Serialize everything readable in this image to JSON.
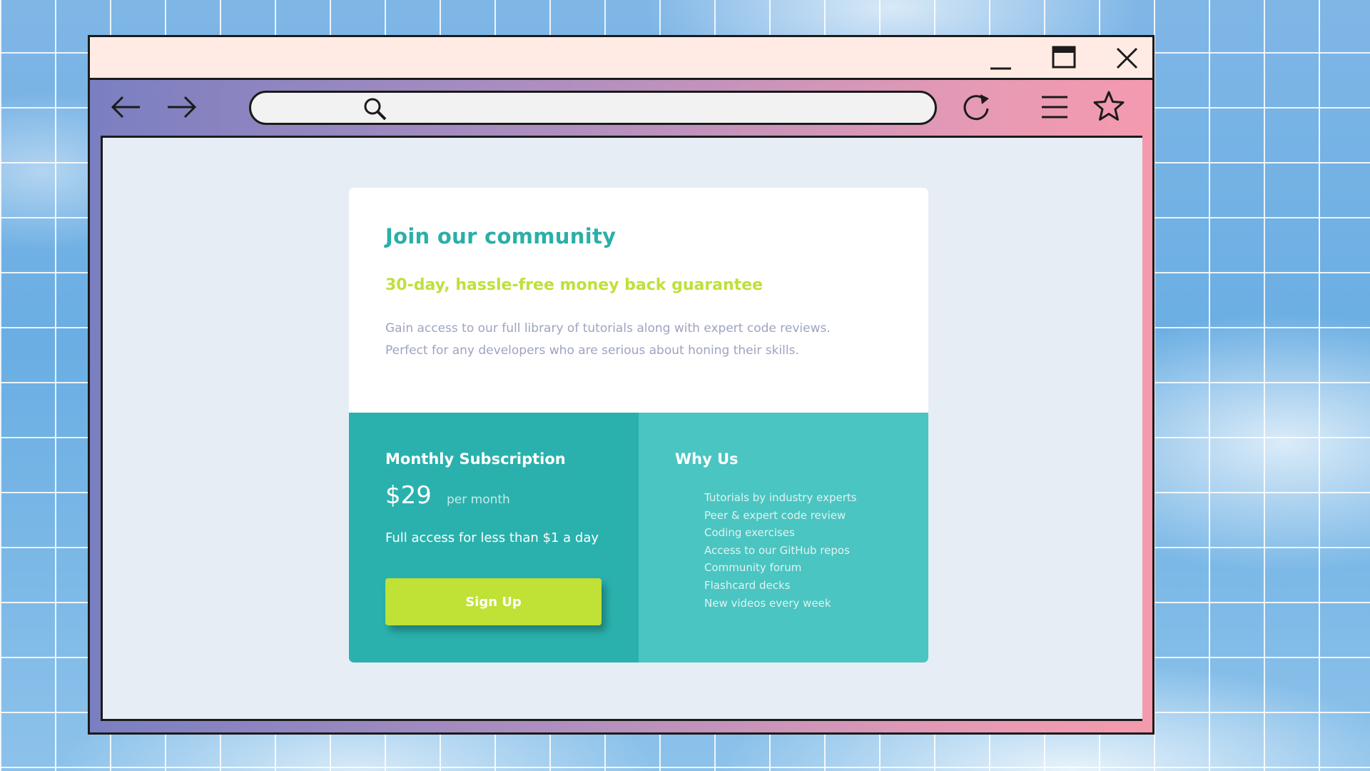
{
  "window": {
    "controls": [
      "minimize-icon",
      "maximize-icon",
      "close-icon"
    ]
  },
  "toolbar": {
    "icons": [
      "back-arrow-icon",
      "forward-arrow-icon",
      "search-icon",
      "refresh-icon",
      "menu-icon",
      "star-icon"
    ],
    "address_value": ""
  },
  "card": {
    "title": "Join our community",
    "guarantee": "30-day, hassle-free money back guarantee",
    "description_line1": "Gain access to our full library of tutorials along with expert code reviews.",
    "description_line2": "Perfect for any developers who are serious about honing their skills."
  },
  "subscription": {
    "title": "Monthly Subscription",
    "price": "$29",
    "period": "per month",
    "tagline": "Full access for less than $1 a day",
    "button_label": "Sign Up"
  },
  "why_us": {
    "title": "Why Us",
    "items": [
      "Tutorials by industry experts",
      "Peer & expert code review",
      "Coding exercises",
      "Access to our GitHub repos",
      "Community forum",
      "Flashcard decks",
      "New videos every week"
    ]
  },
  "colors": {
    "teal_dark": "#2ab1ad",
    "teal_light": "#4ac5c1",
    "accent_green": "#c0e136",
    "title_teal": "#2aafa9",
    "description_gray": "#9ea3c0",
    "titlebar_bg": "#ffebe3",
    "page_bg": "#e6edf5"
  }
}
